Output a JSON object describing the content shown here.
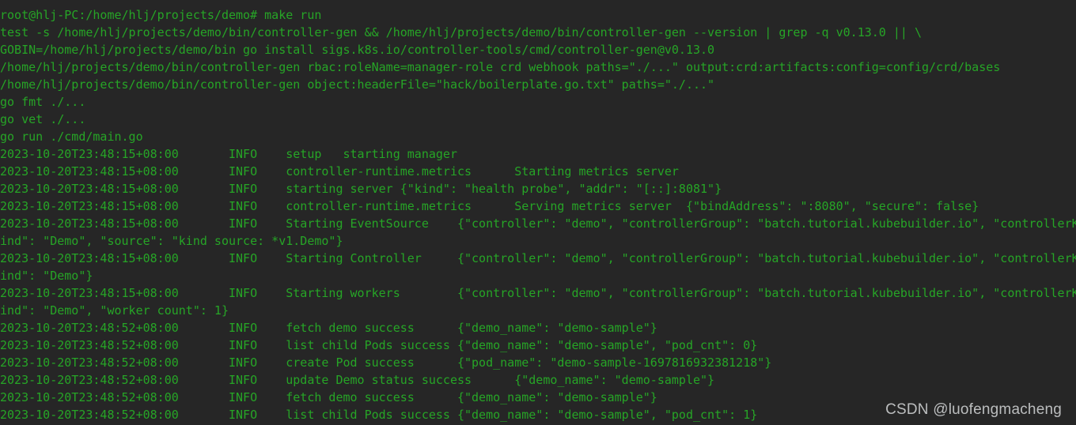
{
  "terminal": {
    "title": "root@hlj-PC: /home/hlj/projects/demo",
    "colors": {
      "background": "#262626",
      "foreground": "#26a526",
      "watermark": "#c8cacb"
    },
    "prompt": {
      "user": "root",
      "host": "hlj-PC",
      "cwd": "/home/hlj/projects/demo",
      "symbol": "#",
      "command": "make run",
      "full_line": "root@hlj-PC:/home/hlj/projects/demo# make run"
    },
    "lines": [
      "root@hlj-PC:/home/hlj/projects/demo# make run",
      "test -s /home/hlj/projects/demo/bin/controller-gen && /home/hlj/projects/demo/bin/controller-gen --version | grep -q v0.13.0 || \\",
      "GOBIN=/home/hlj/projects/demo/bin go install sigs.k8s.io/controller-tools/cmd/controller-gen@v0.13.0",
      "/home/hlj/projects/demo/bin/controller-gen rbac:roleName=manager-role crd webhook paths=\"./...\" output:crd:artifacts:config=config/crd/bases",
      "/home/hlj/projects/demo/bin/controller-gen object:headerFile=\"hack/boilerplate.go.txt\" paths=\"./...\"",
      "go fmt ./...",
      "go vet ./...",
      "go run ./cmd/main.go",
      "2023-10-20T23:48:15+08:00       INFO    setup   starting manager",
      "2023-10-20T23:48:15+08:00       INFO    controller-runtime.metrics      Starting metrics server",
      "2023-10-20T23:48:15+08:00       INFO    starting server {\"kind\": \"health probe\", \"addr\": \"[::]:8081\"}",
      "2023-10-20T23:48:15+08:00       INFO    controller-runtime.metrics      Serving metrics server  {\"bindAddress\": \":8080\", \"secure\": false}",
      "2023-10-20T23:48:15+08:00       INFO    Starting EventSource    {\"controller\": \"demo\", \"controllerGroup\": \"batch.tutorial.kubebuilder.io\", \"controllerK",
      "ind\": \"Demo\", \"source\": \"kind source: *v1.Demo\"}",
      "2023-10-20T23:48:15+08:00       INFO    Starting Controller     {\"controller\": \"demo\", \"controllerGroup\": \"batch.tutorial.kubebuilder.io\", \"controllerK",
      "ind\": \"Demo\"}",
      "2023-10-20T23:48:15+08:00       INFO    Starting workers        {\"controller\": \"demo\", \"controllerGroup\": \"batch.tutorial.kubebuilder.io\", \"controllerK",
      "ind\": \"Demo\", \"worker count\": 1}",
      "2023-10-20T23:48:52+08:00       INFO    fetch demo success      {\"demo_name\": \"demo-sample\"}",
      "2023-10-20T23:48:52+08:00       INFO    list child Pods success {\"demo_name\": \"demo-sample\", \"pod_cnt\": 0}",
      "2023-10-20T23:48:52+08:00       INFO    create Pod success      {\"pod_name\": \"demo-sample-1697816932381218\"}",
      "2023-10-20T23:48:52+08:00       INFO    update Demo status success      {\"demo_name\": \"demo-sample\"}",
      "2023-10-20T23:48:52+08:00       INFO    fetch demo success      {\"demo_name\": \"demo-sample\"}",
      "2023-10-20T23:48:52+08:00       INFO    list child Pods success {\"demo_name\": \"demo-sample\", \"pod_cnt\": 1}"
    ],
    "log_entries": [
      {
        "timestamp": "2023-10-20T23:48:15+08:00",
        "level": "INFO",
        "logger": "setup",
        "message": "starting manager",
        "fields": ""
      },
      {
        "timestamp": "2023-10-20T23:48:15+08:00",
        "level": "INFO",
        "logger": "controller-runtime.metrics",
        "message": "Starting metrics server",
        "fields": ""
      },
      {
        "timestamp": "2023-10-20T23:48:15+08:00",
        "level": "INFO",
        "logger": "",
        "message": "starting server",
        "fields": "{\"kind\": \"health probe\", \"addr\": \"[::]:8081\"}"
      },
      {
        "timestamp": "2023-10-20T23:48:15+08:00",
        "level": "INFO",
        "logger": "controller-runtime.metrics",
        "message": "Serving metrics server",
        "fields": "{\"bindAddress\": \":8080\", \"secure\": false}"
      },
      {
        "timestamp": "2023-10-20T23:48:15+08:00",
        "level": "INFO",
        "logger": "",
        "message": "Starting EventSource",
        "fields": "{\"controller\": \"demo\", \"controllerGroup\": \"batch.tutorial.kubebuilder.io\", \"controllerKind\": \"Demo\", \"source\": \"kind source: *v1.Demo\"}"
      },
      {
        "timestamp": "2023-10-20T23:48:15+08:00",
        "level": "INFO",
        "logger": "",
        "message": "Starting Controller",
        "fields": "{\"controller\": \"demo\", \"controllerGroup\": \"batch.tutorial.kubebuilder.io\", \"controllerKind\": \"Demo\"}"
      },
      {
        "timestamp": "2023-10-20T23:48:15+08:00",
        "level": "INFO",
        "logger": "",
        "message": "Starting workers",
        "fields": "{\"controller\": \"demo\", \"controllerGroup\": \"batch.tutorial.kubebuilder.io\", \"controllerKind\": \"Demo\", \"worker count\": 1}"
      },
      {
        "timestamp": "2023-10-20T23:48:52+08:00",
        "level": "INFO",
        "logger": "",
        "message": "fetch demo success",
        "fields": "{\"demo_name\": \"demo-sample\"}"
      },
      {
        "timestamp": "2023-10-20T23:48:52+08:00",
        "level": "INFO",
        "logger": "",
        "message": "list child Pods success",
        "fields": "{\"demo_name\": \"demo-sample\", \"pod_cnt\": 0}"
      },
      {
        "timestamp": "2023-10-20T23:48:52+08:00",
        "level": "INFO",
        "logger": "",
        "message": "create Pod success",
        "fields": "{\"pod_name\": \"demo-sample-1697816932381218\"}"
      },
      {
        "timestamp": "2023-10-20T23:48:52+08:00",
        "level": "INFO",
        "logger": "",
        "message": "update Demo status success",
        "fields": "{\"demo_name\": \"demo-sample\"}"
      },
      {
        "timestamp": "2023-10-20T23:48:52+08:00",
        "level": "INFO",
        "logger": "",
        "message": "fetch demo success",
        "fields": "{\"demo_name\": \"demo-sample\"}"
      },
      {
        "timestamp": "2023-10-20T23:48:52+08:00",
        "level": "INFO",
        "logger": "",
        "message": "list child Pods success",
        "fields": "{\"demo_name\": \"demo-sample\", \"pod_cnt\": 1}"
      }
    ]
  },
  "watermark": {
    "text": "CSDN @luofengmacheng"
  }
}
